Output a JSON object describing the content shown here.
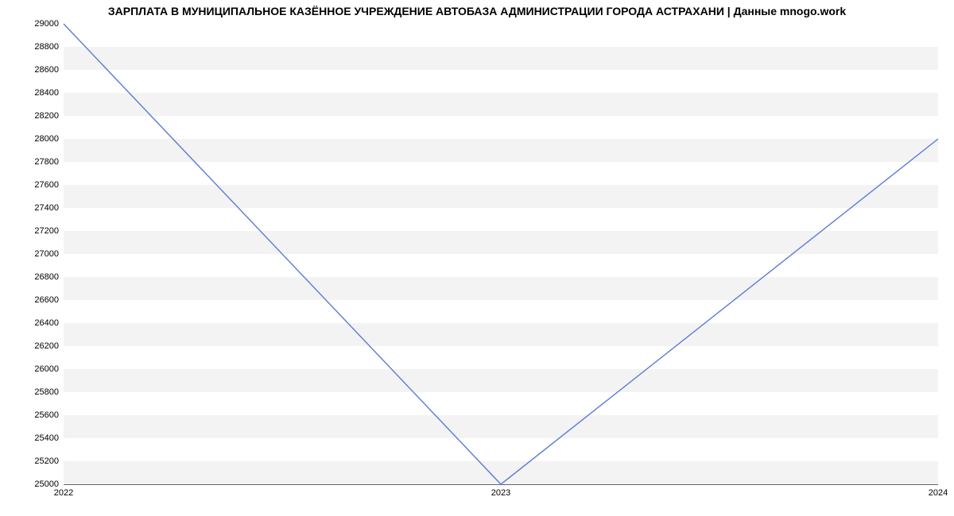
{
  "chart_data": {
    "type": "line",
    "title": "ЗАРПЛАТА В МУНИЦИПАЛЬНОЕ КАЗЁННОЕ УЧРЕЖДЕНИЕ АВТОБАЗА АДМИНИСТРАЦИИ ГОРОДА АСТРАХАНИ | Данные mnogo.work",
    "xlabel": "",
    "ylabel": "",
    "x": [
      "2022",
      "2023",
      "2024"
    ],
    "series": [
      {
        "name": "salary",
        "values": [
          29000,
          25000,
          28000
        ]
      }
    ],
    "y_ticks": [
      25000,
      25200,
      25400,
      25600,
      25800,
      26000,
      26200,
      26400,
      26600,
      26800,
      27000,
      27200,
      27400,
      27600,
      27800,
      28000,
      28200,
      28400,
      28600,
      28800,
      29000
    ],
    "ylim": [
      25000,
      29000
    ]
  }
}
